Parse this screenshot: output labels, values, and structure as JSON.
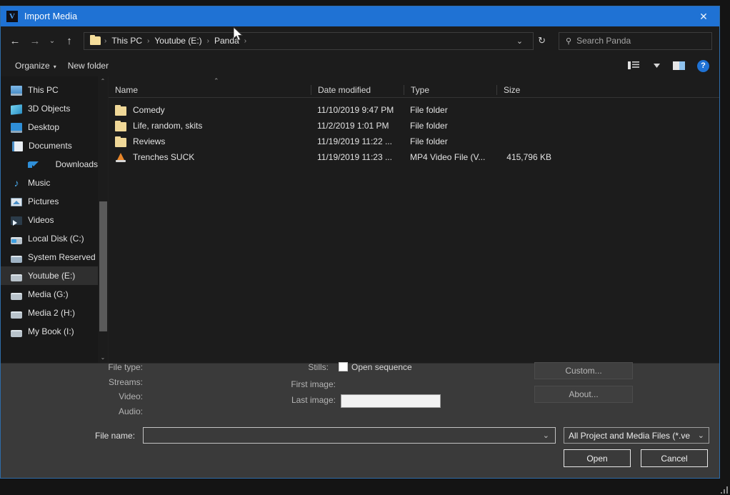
{
  "window": {
    "title": "Import Media",
    "app_icon": "V",
    "close_label": "✕",
    "accent_color": "#1f72d4"
  },
  "nav": {
    "back_icon": "←",
    "forward_icon": "→",
    "recent_icon": "⌄",
    "up_icon": "↑",
    "dropdown_icon": "⌄",
    "refresh_icon": "↻",
    "breadcrumbs": [
      "This PC",
      "Youtube (E:)",
      "Panda"
    ],
    "separator": "›"
  },
  "search": {
    "icon": "search-icon",
    "placeholder": "Search Panda"
  },
  "commandbar": {
    "organize": "Organize",
    "new_folder": "New folder",
    "caret": "▾",
    "help": "?"
  },
  "sidebar": {
    "scroll_up": "⌃",
    "scroll_down": "⌄",
    "items": [
      {
        "label": "This PC",
        "icon": "pc-icon",
        "selected": false
      },
      {
        "label": "3D Objects",
        "icon": "3d-objects-icon",
        "selected": false
      },
      {
        "label": "Desktop",
        "icon": "desktop-icon",
        "selected": false
      },
      {
        "label": "Documents",
        "icon": "documents-icon",
        "selected": false
      },
      {
        "label": "Downloads",
        "icon": "downloads-icon",
        "selected": false
      },
      {
        "label": "Music",
        "icon": "music-icon",
        "selected": false
      },
      {
        "label": "Pictures",
        "icon": "pictures-icon",
        "selected": false
      },
      {
        "label": "Videos",
        "icon": "videos-icon",
        "selected": false
      },
      {
        "label": "Local Disk (C:)",
        "icon": "drive-icon",
        "selected": false
      },
      {
        "label": "System Reserved",
        "icon": "drive-icon",
        "selected": false
      },
      {
        "label": "Youtube (E:)",
        "icon": "drive-icon",
        "selected": true
      },
      {
        "label": "Media (G:)",
        "icon": "drive-icon",
        "selected": false
      },
      {
        "label": "Media 2 (H:)",
        "icon": "drive-icon",
        "selected": false
      },
      {
        "label": "My Book (I:)",
        "icon": "drive-icon",
        "selected": false
      }
    ]
  },
  "filelist": {
    "sort_indicator": "⌃",
    "columns": [
      "Name",
      "Date modified",
      "Type",
      "Size"
    ],
    "rows": [
      {
        "name": "Comedy",
        "date": "11/10/2019 9:47 PM",
        "type": "File folder",
        "size": "",
        "icon": "folder-icon"
      },
      {
        "name": "Life, random, skits",
        "date": "11/2/2019 1:01 PM",
        "type": "File folder",
        "size": "",
        "icon": "folder-icon"
      },
      {
        "name": "Reviews",
        "date": "11/19/2019 11:22 ...",
        "type": "File folder",
        "size": "",
        "icon": "folder-icon"
      },
      {
        "name": "Trenches SUCK",
        "date": "11/19/2019 11:23 ...",
        "type": "MP4 Video File (V...",
        "size": "415,796 KB",
        "icon": "vlc-cone-icon"
      }
    ]
  },
  "details": {
    "file_type_label": "File type:",
    "file_type_value": "",
    "streams_label": "Streams:",
    "streams_value": "",
    "video_label": "Video:",
    "video_value": "",
    "audio_label": "Audio:",
    "audio_value": "",
    "stills_label": "Stills:",
    "open_sequence_label": "Open sequence",
    "open_sequence_checked": false,
    "first_image_label": "First image:",
    "first_image_value": "",
    "last_image_label": "Last image:",
    "last_image_value": "",
    "custom_button": "Custom...",
    "about_button": "About..."
  },
  "footer": {
    "filename_label": "File name:",
    "filename_value": "",
    "filename_caret": "⌄",
    "filter_value": "All Project and Media Files (*.ve",
    "filter_caret": "⌄",
    "open_button": "Open",
    "cancel_button": "Cancel"
  }
}
